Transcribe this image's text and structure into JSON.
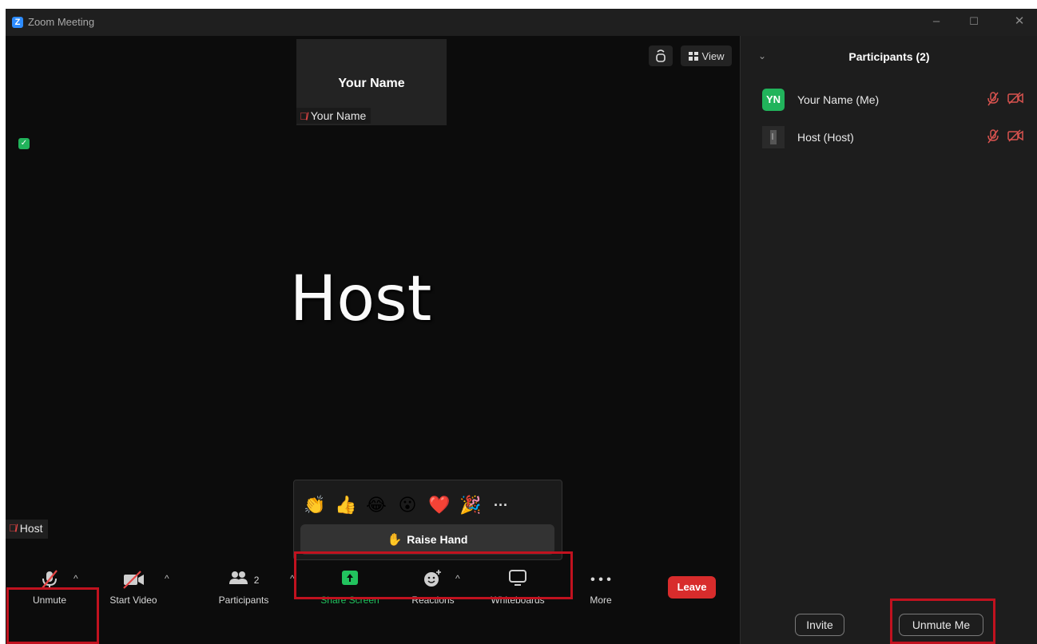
{
  "window": {
    "app_icon_letter": "Z",
    "title": "Zoom Meeting",
    "controls": {
      "minimize": "–",
      "maximize": "☐",
      "close": "✕"
    }
  },
  "video": {
    "thumbnail_name": "Your Name",
    "thumbnail_label": "Your Name",
    "main_speaker_display": "Host",
    "main_speaker_label": "Host",
    "view_button_label": "View"
  },
  "reactions_popup": {
    "emojis": [
      "👏",
      "👍",
      "😂",
      "😮",
      "❤️",
      "🎉"
    ],
    "more": "···",
    "raise_hand_label": "Raise Hand"
  },
  "toolbar": {
    "unmute": "Unmute",
    "start_video": "Start Video",
    "participants": "Participants",
    "participants_count": "2",
    "share_screen": "Share Screen",
    "reactions": "Reactions",
    "whiteboards": "Whiteboards",
    "more": "More",
    "leave": "Leave",
    "share_color": "#22c35e",
    "leave_color": "#d82c2c"
  },
  "participants_panel": {
    "title": "Participants (2)",
    "participants": [
      {
        "initials": "YN",
        "name": "Your Name (Me)",
        "avatar_color": "#21b35b"
      },
      {
        "initials": "",
        "name": "Host (Host)",
        "avatar_color": "#2f2f2f"
      }
    ],
    "invite_label": "Invite",
    "unmute_me_label": "Unmute Me"
  }
}
